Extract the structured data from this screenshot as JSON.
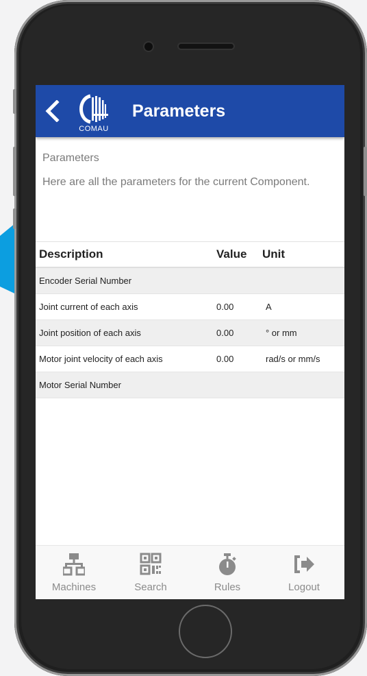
{
  "header": {
    "title": "Parameters",
    "logo_text": "COMAU",
    "back_icon": "chevron-left-icon"
  },
  "intro": {
    "heading": "Parameters",
    "text": "Here are all the parameters for the current Component."
  },
  "table": {
    "columns": [
      "Description",
      "Value",
      "Unit"
    ],
    "rows": [
      {
        "description": "Encoder Serial Number",
        "value": "",
        "unit": ""
      },
      {
        "description": "Joint current of each axis",
        "value": "0.00",
        "unit": "A"
      },
      {
        "description": "Joint position of each axis",
        "value": "0.00",
        "unit": "° or mm"
      },
      {
        "description": "Motor joint velocity of each axis",
        "value": "0.00",
        "unit": "rad/s or mm/s"
      },
      {
        "description": "Motor Serial Number",
        "value": "",
        "unit": ""
      }
    ]
  },
  "nav": {
    "items": [
      {
        "label": "Machines",
        "icon": "network-icon"
      },
      {
        "label": "Search",
        "icon": "qr-code-icon"
      },
      {
        "label": "Rules",
        "icon": "stopwatch-icon"
      },
      {
        "label": "Logout",
        "icon": "logout-icon"
      }
    ]
  },
  "colors": {
    "header_bg": "#1e4aa8",
    "accent_arrow": "#0c9ee0",
    "nav_icon": "#8b8b8b"
  }
}
